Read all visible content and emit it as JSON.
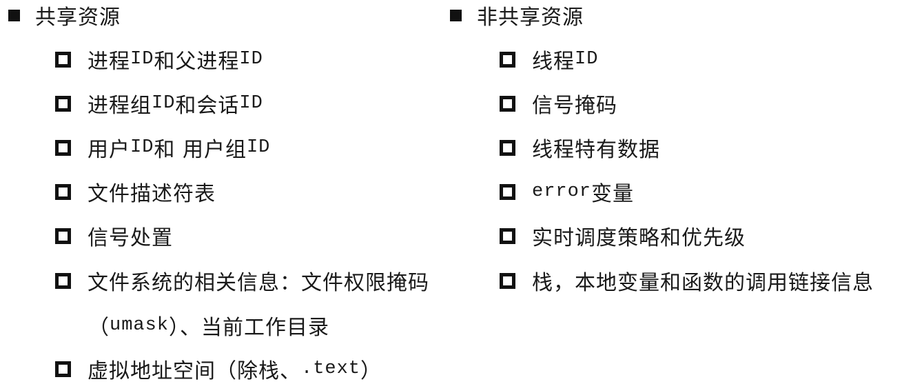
{
  "left": {
    "heading": "共享资源",
    "items": [
      {
        "parts": [
          "进程 ",
          "ID",
          " 和父进程 ",
          "ID"
        ]
      },
      {
        "parts": [
          "进程组 ",
          "ID",
          " 和会话 ",
          "ID"
        ]
      },
      {
        "parts": [
          "用户 ",
          "ID",
          " 和 用户组 ",
          "ID"
        ]
      },
      {
        "parts": [
          "文件描述符表"
        ]
      },
      {
        "parts": [
          "信号处置"
        ]
      },
      {
        "parts": [
          "文件系统的相关信息：文件权限掩码"
        ],
        "continuation": [
          "（",
          "umask",
          "）、当前工作目录"
        ]
      },
      {
        "parts": [
          "虚拟地址空间（除栈、",
          ".text",
          "）"
        ]
      }
    ]
  },
  "right": {
    "heading": "非共享资源",
    "items": [
      {
        "parts": [
          "线程 ",
          "ID"
        ]
      },
      {
        "parts": [
          "信号掩码"
        ]
      },
      {
        "parts": [
          "线程特有数据"
        ]
      },
      {
        "parts": [
          "error",
          " 变量"
        ]
      },
      {
        "parts": [
          "实时调度策略和优先级"
        ]
      },
      {
        "parts": [
          "栈，本地变量和函数的调用链接信息"
        ]
      }
    ]
  }
}
